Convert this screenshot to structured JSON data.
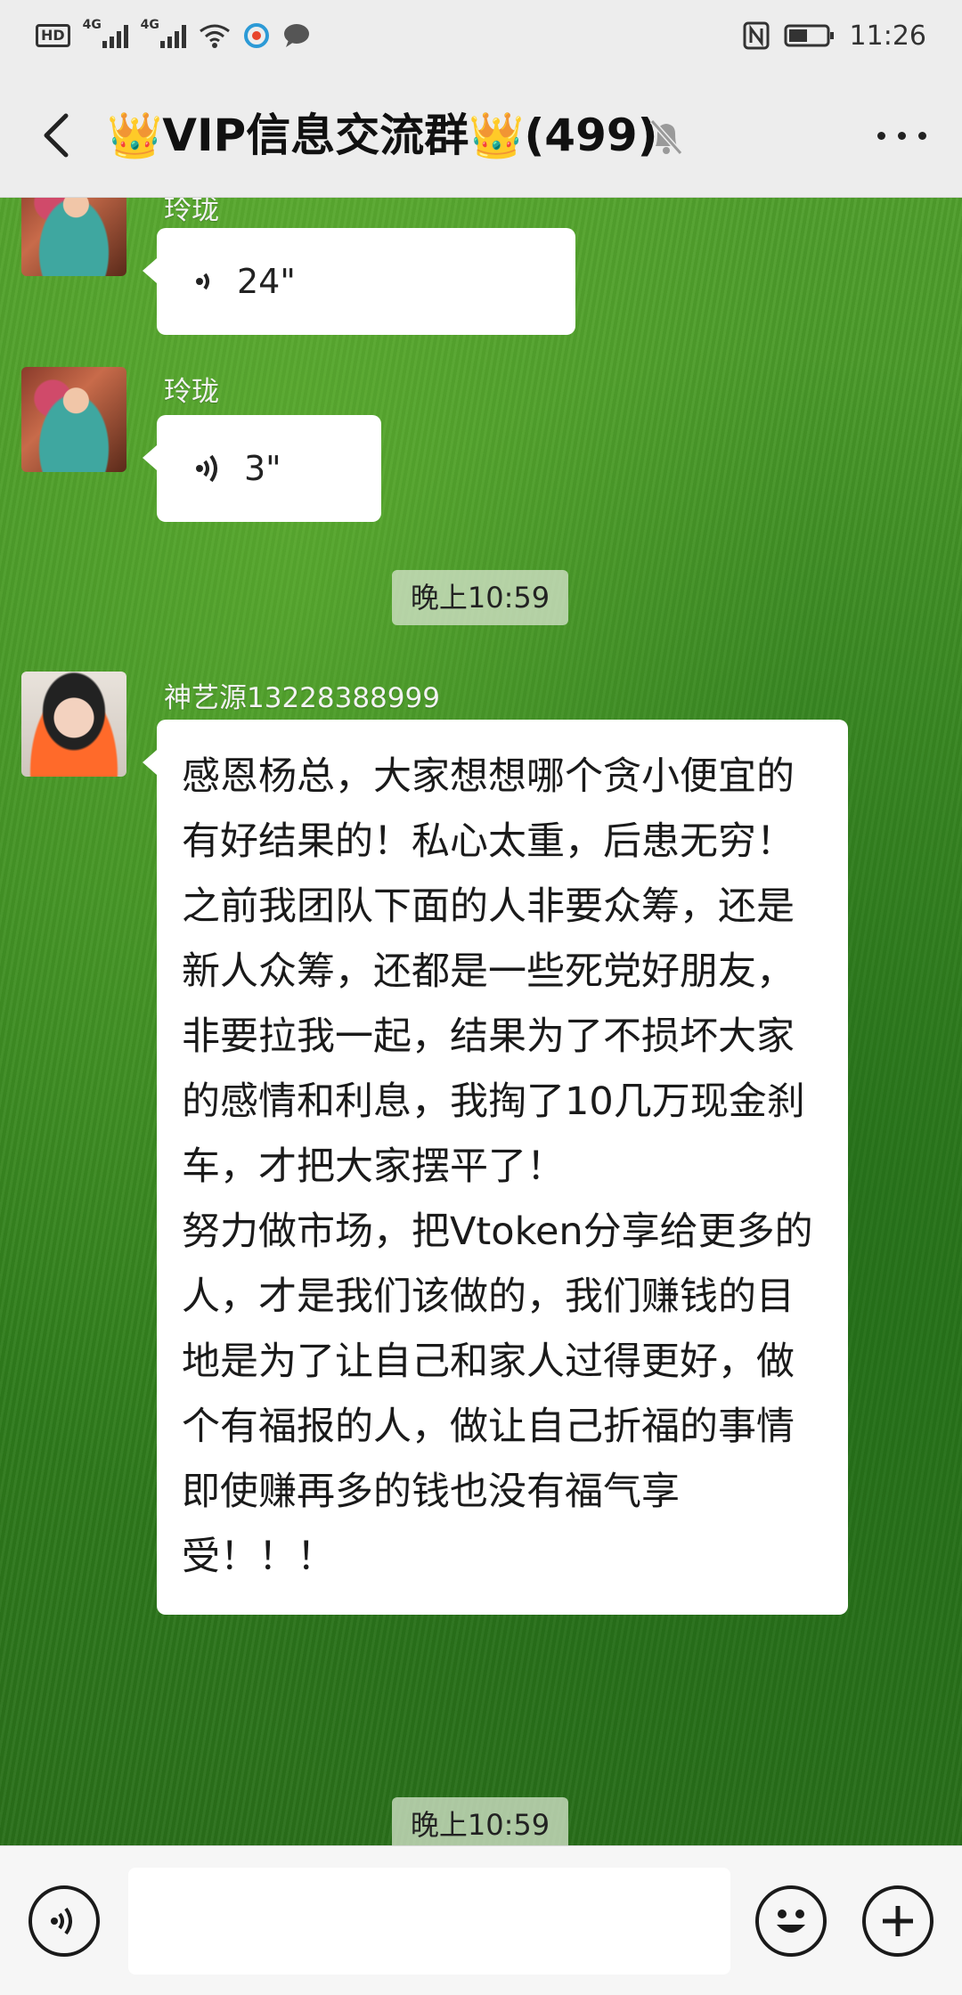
{
  "status_bar": {
    "hd": "HD",
    "network_1": "4G",
    "network_2": "4G",
    "time": "11:26"
  },
  "header": {
    "title": "👑VIP信息交流群👑(499)",
    "back_icon": "chevron-left-icon",
    "mute_icon": "bell-off-icon",
    "more_icon": "more-dots-icon"
  },
  "messages": [
    {
      "type": "voice",
      "sender": "玲珑",
      "duration": "24\""
    },
    {
      "type": "voice",
      "sender": "玲珑",
      "duration": "3\""
    },
    {
      "type": "timestamp",
      "text": "晚上10:59"
    },
    {
      "type": "text",
      "sender": "神艺源13228388999",
      "text": "感恩杨总，大家想想哪个贪小便宜的有好结果的！私心太重，后患无穷！\n之前我团队下面的人非要众筹，还是新人众筹，还都是一些死党好朋友，非要拉我一起，结果为了不损坏大家的感情和利息，我掏了10几万现金刹车，才把大家摆平了！\n努力做市场，把Vtoken分享给更多的人，才是我们该做的，我们赚钱的目地是为了让自己和家人过得更好，做个有福报的人，做让自己折福的事情即使赚再多的钱也没有福气享受！！！"
    },
    {
      "type": "timestamp",
      "text": "晚上10:59"
    }
  ],
  "input_bar": {
    "voice_icon": "voice-icon",
    "emoji_icon": "emoji-icon",
    "plus_icon": "plus-icon",
    "placeholder": ""
  },
  "colors": {
    "chat_bg": "#3f8f24",
    "bar_bg": "#ededed",
    "bubble_bg": "#ffffff"
  }
}
